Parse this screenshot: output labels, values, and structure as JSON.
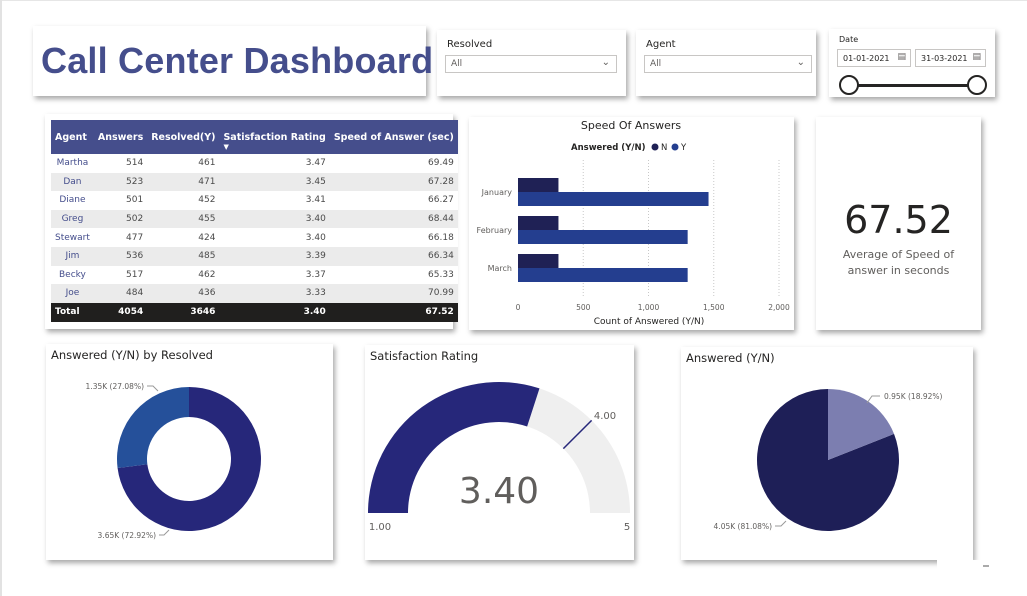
{
  "title": "Call Center Dashboard",
  "slicers": {
    "resolved": {
      "label": "Resolved",
      "value": "All"
    },
    "agent": {
      "label": "Agent",
      "value": "All"
    },
    "date": {
      "label": "Date",
      "start": "01-01-2021",
      "end": "31-03-2021"
    }
  },
  "table": {
    "headers": [
      "Agent",
      "Answers",
      "Resolved(Y)",
      "Satisfaction Rating",
      "Speed of Answer (sec)"
    ],
    "rows": [
      [
        "Martha",
        "514",
        "461",
        "3.47",
        "69.49"
      ],
      [
        "Dan",
        "523",
        "471",
        "3.45",
        "67.28"
      ],
      [
        "Diane",
        "501",
        "452",
        "3.41",
        "66.27"
      ],
      [
        "Greg",
        "502",
        "455",
        "3.40",
        "68.44"
      ],
      [
        "Stewart",
        "477",
        "424",
        "3.40",
        "66.18"
      ],
      [
        "Jim",
        "536",
        "485",
        "3.39",
        "66.34"
      ],
      [
        "Becky",
        "517",
        "462",
        "3.37",
        "65.33"
      ],
      [
        "Joe",
        "484",
        "436",
        "3.33",
        "70.99"
      ]
    ],
    "total": [
      "Total",
      "4054",
      "3646",
      "3.40",
      "67.52"
    ]
  },
  "kpi": {
    "value": "67.52",
    "label": "Average of Speed of answer in seconds"
  },
  "colors": {
    "n": "#1f2155",
    "y": "#243e8f",
    "accent": "#454e8c",
    "resolved_y": "#25509a",
    "gauge_fill": "#26277a",
    "gauge_rest": "#efefef",
    "pie_main": "#1e1f57",
    "pie_slice": "#7c7eb0"
  },
  "chart_data": [
    {
      "type": "bar",
      "title": "Speed Of Answers",
      "legend_title": "Answered (Y/N)",
      "legend_position": "top",
      "xlabel": "Count of Answered (Y/N)",
      "ylabel": "",
      "categories": [
        "January",
        "February",
        "March"
      ],
      "series": [
        {
          "name": "N",
          "values": [
            310,
            310,
            310
          ]
        },
        {
          "name": "Y",
          "values": [
            1460,
            1300,
            1300
          ]
        }
      ],
      "xlim": [
        0,
        2000
      ],
      "xticks": [
        "0",
        "500",
        "1,000",
        "1,500",
        "2,000"
      ]
    },
    {
      "type": "pie",
      "title": "Answered (Y/N) by Resolved",
      "donut": true,
      "values": [
        3.65,
        1.35
      ],
      "labels": [
        "3.65K (72.92%)",
        "1.35K (27.08%)"
      ]
    },
    {
      "type": "gauge",
      "title": "Satisfaction Rating",
      "value": 3.4,
      "display": "3.40",
      "min": 1,
      "max": 5,
      "target": 4.0,
      "min_label": "1.00",
      "max_label": "5",
      "target_label": "4.00"
    },
    {
      "type": "pie",
      "title": "Answered (Y/N)",
      "values": [
        4.05,
        0.95
      ],
      "labels": [
        "4.05K (81.08%)",
        "0.95K (18.92%)"
      ]
    }
  ]
}
